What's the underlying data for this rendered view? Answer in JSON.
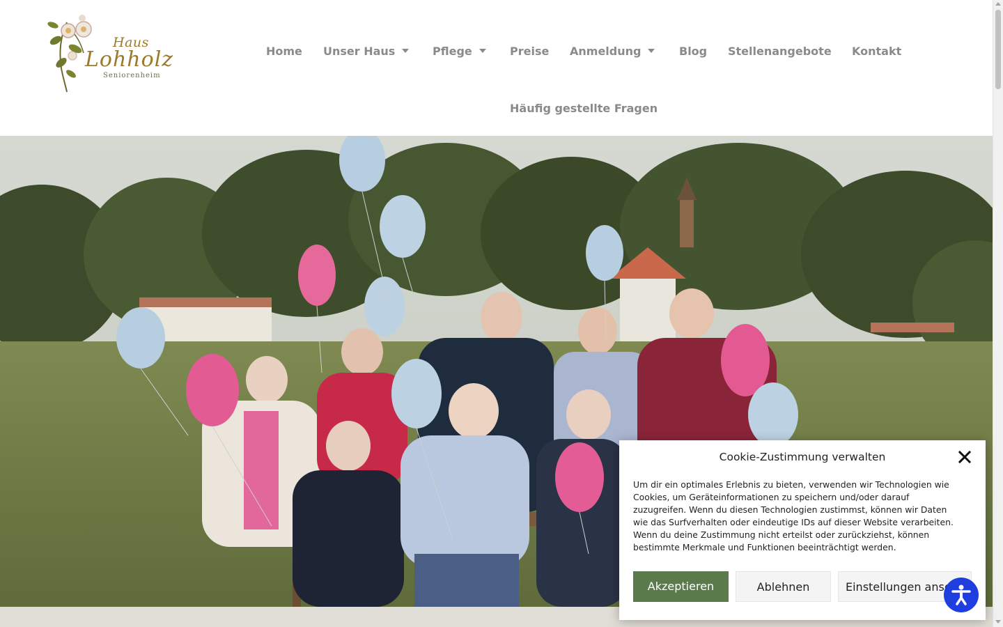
{
  "logo": {
    "top": "Haus",
    "main": "Lohholz",
    "sub": "Seniorenheim"
  },
  "nav": {
    "home": "Home",
    "unser_haus": "Unser Haus",
    "pflege": "Pflege",
    "preise": "Preise",
    "anmeldung": "Anmeldung",
    "blog": "Blog",
    "stellenangebote": "Stellenangebote",
    "kontakt": "Kontakt",
    "faq": "Häufig gestellte Fragen"
  },
  "cookie": {
    "title": "Cookie-Zustimmung verwalten",
    "text": "Um dir ein optimales Erlebnis zu bieten, verwenden wir Technologien wie Cookies, um Geräteinformationen zu speichern und/oder darauf zuzugreifen. Wenn du diesen Technologien zustimmst, können wir Daten wie das Surfverhalten oder eindeutige IDs auf dieser Website verarbeiten. Wenn du deine Zustimmung nicht erteilst oder zurückziehst, können bestimmte Merkmale und Funktionen beeinträchtigt werden.",
    "accept": "Akzeptieren",
    "deny": "Ablehnen",
    "settings": "Einstellungen ansehen"
  },
  "colors": {
    "nav_text": "#8a8a8a",
    "accept_button": "#5b7a4c",
    "accessibility_button": "#1f3ee0",
    "logo_gold": "#9b7a2c"
  },
  "icons": {
    "close": "close-icon",
    "accessibility": "accessibility-icon",
    "dropdown": "chevron-down-icon"
  }
}
